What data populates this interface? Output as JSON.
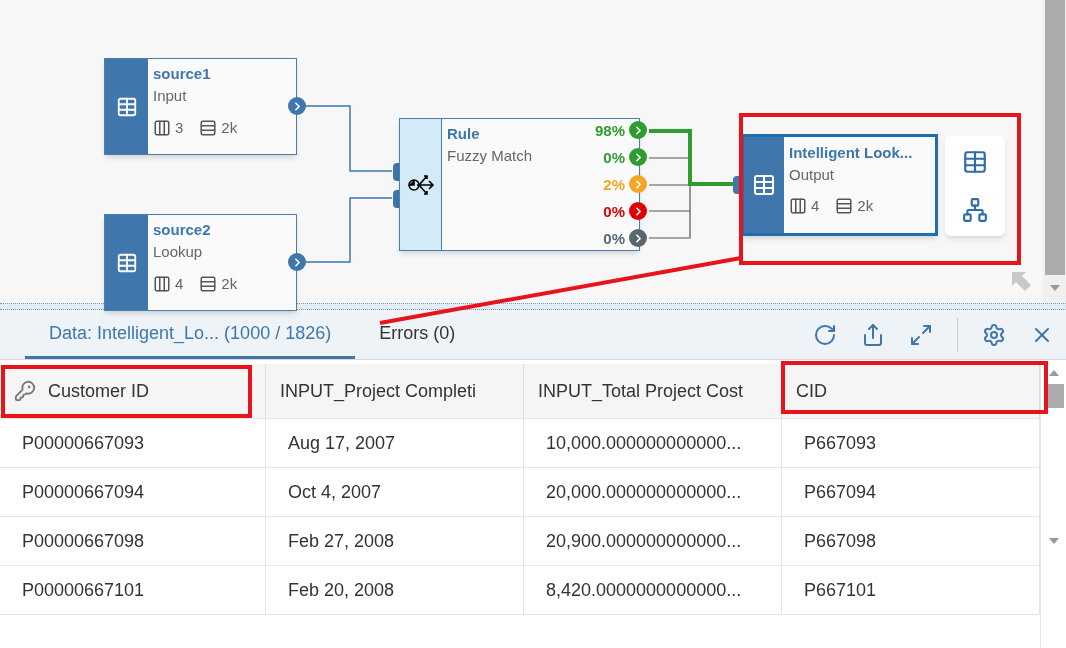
{
  "canvas": {
    "nodes": [
      {
        "kind": "source",
        "title": "source1",
        "subtitle": "Input",
        "columns": "3",
        "rows": "2k",
        "selected": false
      },
      {
        "kind": "source",
        "title": "source2",
        "subtitle": "Lookup",
        "columns": "4",
        "rows": "2k",
        "selected": false
      },
      {
        "kind": "rule",
        "title": "Rule",
        "subtitle": "Fuzzy Match",
        "selected": false,
        "outputs": [
          {
            "label": "98%",
            "color": "#2e9c2e"
          },
          {
            "label": "0%",
            "color": "#2e9c2e"
          },
          {
            "label": "2%",
            "color": "#f5a623"
          },
          {
            "label": "0%",
            "color": "#e30000"
          },
          {
            "label": "0%",
            "color": "#5b6770"
          }
        ]
      },
      {
        "kind": "output",
        "title": "Intelligent Look...",
        "subtitle": "Output",
        "columns": "4",
        "rows": "2k",
        "selected": true
      }
    ]
  },
  "panel": {
    "tabs": [
      {
        "label": "Data: Intelligent_Lo... (1000 / 1826)",
        "selected": true
      },
      {
        "label": "Errors (0)",
        "selected": false
      }
    ],
    "table": {
      "columns": [
        {
          "label": "Customer ID",
          "key": true
        },
        {
          "label": "INPUT_Project Completi",
          "key": false
        },
        {
          "label": "INPUT_Total Project Cost",
          "key": false
        },
        {
          "label": "CID",
          "key": false
        }
      ],
      "rows": [
        [
          "P00000667093",
          "Aug 17, 2007",
          "10,000.000000000000...",
          "P667093"
        ],
        [
          "P00000667094",
          "Oct 4, 2007",
          "20,000.000000000000...",
          "P667094"
        ],
        [
          "P00000667098",
          "Feb 27, 2008",
          "20,900.000000000000...",
          "P667098"
        ],
        [
          "P00000667101",
          "Feb 20, 2008",
          "8,420.0000000000000...",
          "P667101"
        ]
      ]
    }
  }
}
